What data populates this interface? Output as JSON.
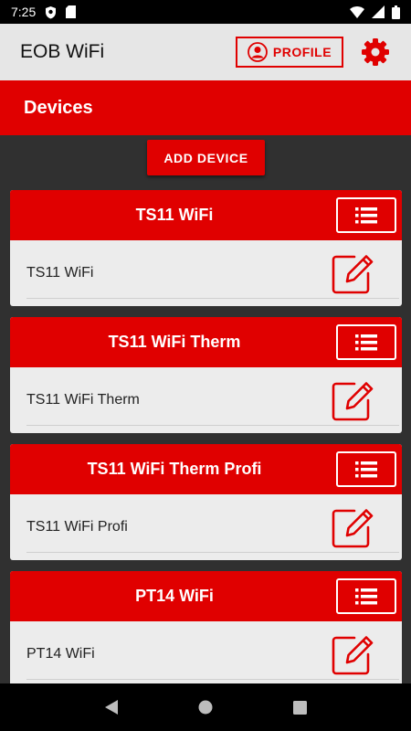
{
  "status_bar": {
    "time": "7:25",
    "icons": [
      "shield-icon",
      "sd-card-icon",
      "wifi-icon",
      "signal-icon",
      "battery-icon"
    ]
  },
  "app_bar": {
    "title": "EOB WiFi",
    "profile_label": "PROFILE",
    "settings_icon": "gear-icon"
  },
  "section": {
    "title": "Devices"
  },
  "add_device_label": "ADD DEVICE",
  "devices": [
    {
      "header": "TS11 WiFi",
      "name": "TS11 WiFi"
    },
    {
      "header": "TS11 WiFi Therm",
      "name": "TS11 WiFi Therm"
    },
    {
      "header": "TS11 WiFi Therm Profi",
      "name": "TS11 WiFi Profi"
    },
    {
      "header": "PT14 WiFi",
      "name": "PT14 WiFi"
    }
  ],
  "nav_bar": {
    "icons": [
      "back-icon",
      "home-icon",
      "recents-icon"
    ]
  },
  "colors": {
    "accent": "#e00000",
    "background": "#303030",
    "card": "#ececec",
    "app_bar": "#e6e6e6"
  }
}
